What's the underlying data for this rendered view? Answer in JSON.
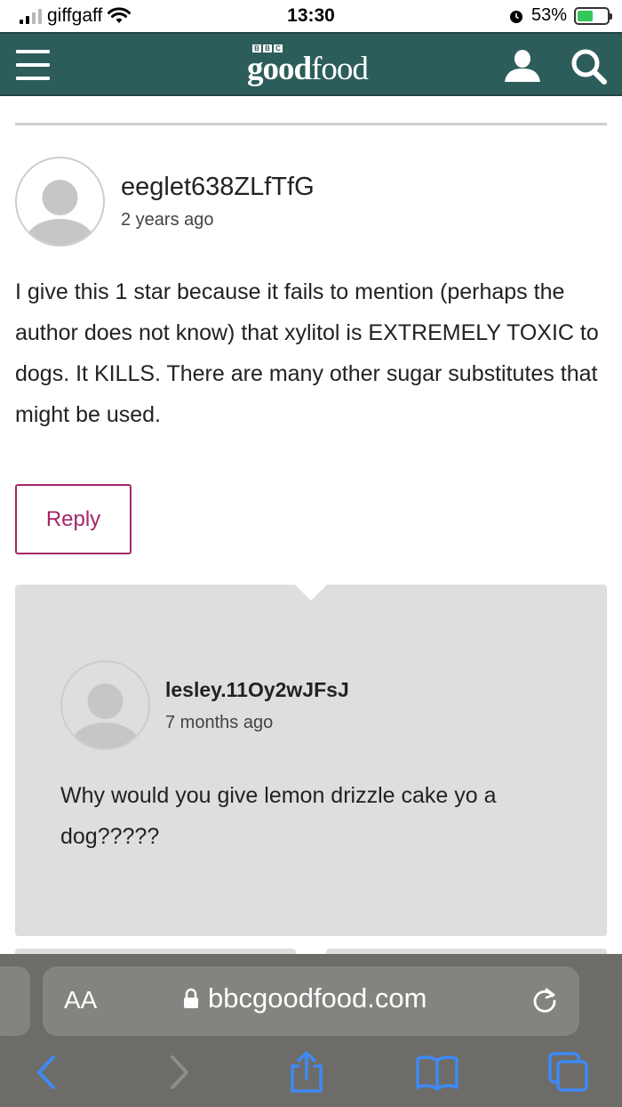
{
  "status_bar": {
    "carrier": "giffgaff",
    "time": "13:30",
    "battery": "53%",
    "battery_level": 0.53
  },
  "header": {
    "logo_bbc": [
      "B",
      "B",
      "C"
    ],
    "logo_text_bold": "good",
    "logo_text_light": "food",
    "menu_icon": "hamburger-icon",
    "account_icon": "user-icon",
    "search_icon": "search-icon",
    "color": "#2d5d5a"
  },
  "comment": {
    "author": "eeglet638ZLfTfG",
    "time": "2 years ago",
    "body": "I give this 1 star because it fails to mention (perhaps the author does not know) that xylitol is EXTREMELY TOXIC to dogs. It KILLS. There are many other sugar substitutes that might be used.",
    "reply_label": "Reply",
    "accent_color": "#a4266a"
  },
  "reply": {
    "author": "lesley.11Oy2wJFsJ",
    "time": "7 months ago",
    "body": "Why would you give lemon drizzle cake yo a dog?????"
  },
  "browser": {
    "aa_label": "AA",
    "url": "bbcgoodfood.com",
    "lock_icon": "lock-icon",
    "reload_icon": "reload-icon",
    "toolbar_icons": [
      "back-icon",
      "forward-icon",
      "share-icon",
      "bookmarks-icon",
      "tabs-icon"
    ]
  }
}
